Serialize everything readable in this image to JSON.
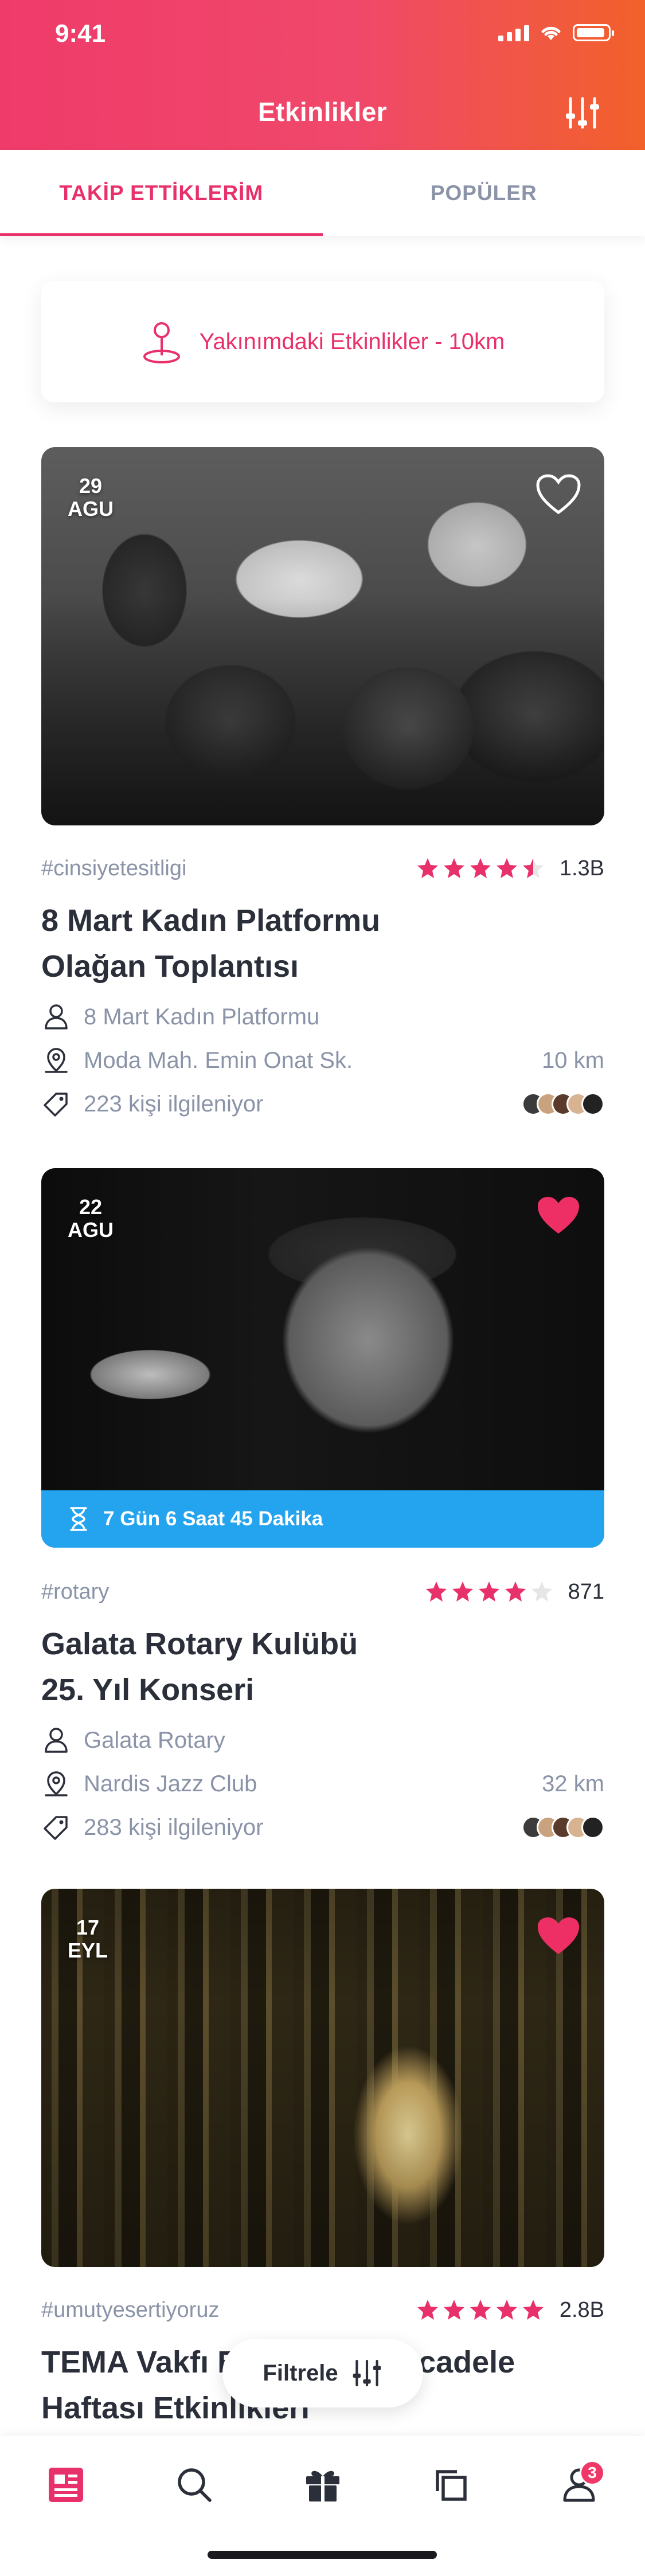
{
  "status": {
    "time": "9:41"
  },
  "header": {
    "title": "Etkinlikler",
    "filter_icon": "sliders-icon"
  },
  "tabs": [
    {
      "label": "TAKİP ETTİKLERİM",
      "active": true
    },
    {
      "label": "POPÜLER",
      "active": false
    }
  ],
  "nearby": {
    "label": "Yakınımdaki Etkinlikler - 10km",
    "icon": "location-pin-icon"
  },
  "events": [
    {
      "day": "29",
      "month": "AGU",
      "favorite": false,
      "tag": "#cinsiyetesitligi",
      "rating": 4.5,
      "rating_count": "1.3B",
      "title": "8 Mart Kadın Platformu Olağan Toplantısı",
      "organizer": "8 Mart Kadın Platformu",
      "location": "Moda Mah. Emin Onat Sk.",
      "distance": "10 km",
      "interested": "223 kişi ilgileniyor"
    },
    {
      "day": "22",
      "month": "AGU",
      "favorite": true,
      "countdown": "7 Gün 6 Saat 45 Dakika",
      "tag": "#rotary",
      "rating": 4,
      "rating_count": "871",
      "title": "Galata Rotary Kulübü 25. Yıl Konseri",
      "organizer": "Galata Rotary",
      "location": "Nardis Jazz Club",
      "distance": "32 km",
      "interested": "283 kişi ilgileniyor"
    },
    {
      "day": "17",
      "month": "EYL",
      "favorite": true,
      "tag": "#umutyesertiyoruz",
      "rating": 5,
      "rating_count": "2.8B",
      "title": "TEMA Vakfı Erozyonla Mücadele Haftası Etkinlikleri"
    }
  ],
  "floating_filter": {
    "label": "Filtrele"
  },
  "bottom_nav": {
    "items": [
      "news-icon",
      "search-icon",
      "gift-icon",
      "copy-icon",
      "profile-icon"
    ],
    "profile_badge": "3"
  },
  "colors": {
    "accent": "#e8306a",
    "timer": "#24a3ee",
    "muted": "#8a93a7"
  }
}
